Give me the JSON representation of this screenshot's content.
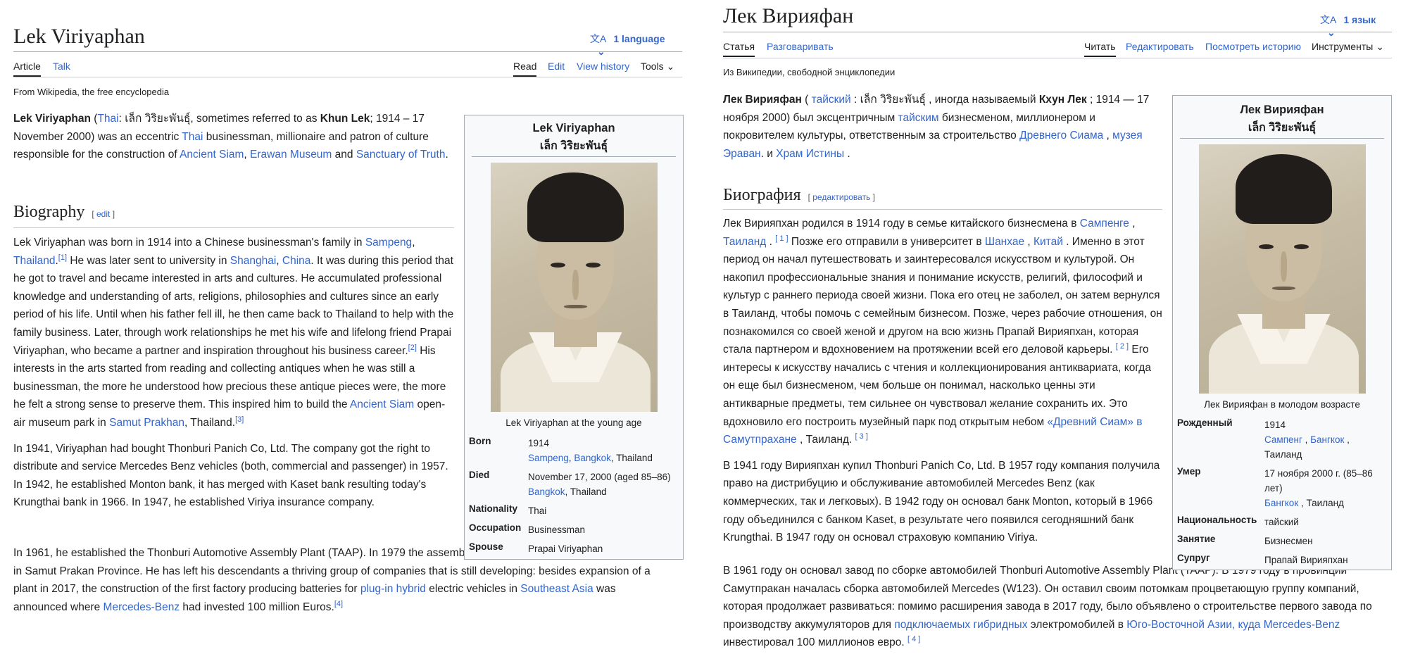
{
  "en": {
    "title": "Lek Viriyaphan",
    "language_button": "1 language",
    "tabs_left": [
      "Article",
      "Talk"
    ],
    "tabs_right": [
      "Read",
      "Edit",
      "View history",
      "Tools"
    ],
    "from": "From Wikipedia, the free encyclopedia",
    "lead": {
      "b1": "Lek Viriyaphan",
      "t1": " (",
      "l1": "Thai",
      "t2": ": เล็ก วิริยะพันธุ์, sometimes referred to as ",
      "b2": "Khun Lek",
      "t3": "; 1914 – 17 November 2000) was an eccentric ",
      "l2": "Thai",
      "t4": " businessman, millionaire and patron of culture responsible for the construction of ",
      "l3": "Ancient Siam",
      "t5": ", ",
      "l4": "Erawan Museum",
      "t6": " and ",
      "l5": "Sanctuary of Truth",
      "t7": "."
    },
    "heading": "Biography",
    "edit_label": "edit",
    "p1": {
      "t1": "Lek Viriyaphan was born in 1914 into a Chinese businessman's family in ",
      "l1": "Sampeng",
      "t2": ", ",
      "l2": "Thailand",
      "t3": ".",
      "r1": "[1]",
      "t4": " He was later sent to university in ",
      "l3": "Shanghai",
      "t5": ", ",
      "l4": "China",
      "t6": ". It was during this period that he got to travel and became interested in arts and cultures. He accumulated professional knowledge and understanding of arts, religions, philosophies and cultures since an early period of his life. Until when his father fell ill, he then came back to Thailand to help with the family business. Later, through work relationships he met his wife and lifelong friend Prapai Viriyaphan, who became a partner and inspiration throughout his business career.",
      "r2": "[2]",
      "t7": " His interests in the arts started from reading and collecting antiques when he was still a businessman, the more he understood how precious these antique pieces were, the more he felt a strong sense to preserve them. This inspired him to build the ",
      "l5": "Ancient Siam",
      "t8": " open-air museum park in ",
      "l6": "Samut Prakhan",
      "t9": ", Thailand.",
      "r3": "[3]"
    },
    "p2": "In 1941, Viriyaphan had bought Thonburi Panich Co, Ltd. The company got the right to distribute and service Mercedes Benz vehicles (both, commercial and passenger) in 1957. In 1942, he established Monton bank, it has merged with Kaset bank resulting today's Krungthai bank in 1966. In 1947, he established Viriya insurance company.",
    "p3": {
      "t1": "In 1961, he established the Thonburi Automotive Assembly Plant (TAAP). In 1979 the assembly of Mercedes cars (W123) was started in Samut Prakan Province. He has left his descendants a thriving group of companies that is still developing: besides expansion of a plant in 2017, the construction of the first factory producing batteries for ",
      "l1": "plug-in hybrid",
      "t2": " electric vehicles in ",
      "l2": "Southeast Asia",
      "t3": " was announced where ",
      "l3": "Mercedes-Benz",
      "t4": " had invested 100 million Euros.",
      "r1": "[4]"
    },
    "infobox": {
      "name": "Lek Viriyaphan",
      "native_name": "เล็ก วิริยะพันธุ์",
      "caption": "Lek Viriyaphan at the young age",
      "born_label": "Born",
      "born_year": "1914",
      "born_place_1": "Sampeng",
      "born_place_2": "Bangkok",
      "born_country": "Thailand",
      "died_label": "Died",
      "died_date": "November 17, 2000 (aged 85–86)",
      "died_place": "Bangkok",
      "died_country": "Thailand",
      "nationality_label": "Nationality",
      "nationality": "Thai",
      "occupation_label": "Occupation",
      "occupation": "Businessman",
      "spouse_label": "Spouse",
      "spouse": "Prapai Viriyaphan"
    }
  },
  "ru": {
    "title": "Лек Вирияфан",
    "language_button": "1 язык",
    "tabs_left": [
      "Статья",
      "Разговаривать"
    ],
    "tabs_right": [
      "Читать",
      "Редактировать",
      "Посмотреть историю",
      "Инструменты"
    ],
    "from": "Из Википедии, свободной энциклопедии",
    "lead": {
      "b1": "Лек Вирияфан",
      "t1": " ( ",
      "l1": "тайский",
      "t2": " : เล็ก วิริยะพันธุ์ , иногда называемый ",
      "b2": "Кхун Лек",
      "t3": " ; 1914 — 17 ноября 2000) был эксцентричным ",
      "l2": "тайским",
      "t4": " бизнесменом, миллионером и покровителем культуры, ответственным за строительство ",
      "l3": "Древнего Сиама",
      "t5": " , ",
      "l4": "музея Эраван",
      "t6": ". и ",
      "l5": "Храм Истины",
      "t7": " ."
    },
    "heading": "Биография",
    "edit_label": "редактировать",
    "p1": {
      "t1": "Лек Вирияпхан родился в 1914 году в семье китайского бизнесмена в ",
      "l1": "Сампенге",
      "t2": " , ",
      "l2": "Таиланд",
      "t3": " . ",
      "r1": "[ 1 ]",
      "t4": " Позже его отправили в университет в ",
      "l3": "Шанхае",
      "t5": " , ",
      "l4": "Китай",
      "t6": " . Именно в этот период он начал путешествовать и заинтересовался искусством и культурой. Он накопил профессиональные знания и понимание искусств, религий, философий и культур с раннего периода своей жизни. Пока его отец не заболел, он затем вернулся в Таиланд, чтобы помочь с семейным бизнесом. Позже, через рабочие отношения, он познакомился со своей женой и другом на всю жизнь Прапай Вирияпхан, которая стала партнером и вдохновением на протяжении всей его деловой карьеры. ",
      "r2": "[ 2 ]",
      "t7": " Его интересы к искусству начались с чтения и коллекционирования антиквариата, когда он еще был бизнесменом, чем больше он понимал, насколько ценны эти антикварные предметы, тем сильнее он чувствовал желание сохранить их. Это вдохновило его построить музейный парк под открытым небом ",
      "l5": "«Древний Сиам» в Самутпрахане",
      "t8": " , Таиланд. ",
      "r3": "[ 3 ]"
    },
    "p2": "В 1941 году Вирияпхан купил Thonburi Panich Co, Ltd. В 1957 году компания получила право на дистрибуцию и обслуживание автомобилей Mercedes Benz (как коммерческих, так и легковых). В 1942 году он основал банк Monton, который в 1966 году объединился с банком Kaset, в результате чего появился сегодняшний банк Krungthai. В 1947 году он основал страховую компанию Viriya.",
    "p3": {
      "t1": "В 1961 году он основал завод по сборке автомобилей Thonburi Automotive Assembly Plant (TAAP). В 1979 году в провинции Самутпракан началась сборка автомобилей Mercedes (W123). Он оставил своим потомкам процветающую группу компаний, которая продолжает развиваться: помимо расширения завода в 2017 году, было объявлено о строительстве первого завода по производству аккумуляторов для ",
      "l1": "подключаемых гибридных",
      "t2": " электромобилей в ",
      "l2": "Юго-Восточной Азии, куда Mercedes-Benz",
      "t3": " инвестировал 100 миллионов евро. ",
      "r1": "[ 4 ]"
    },
    "infobox": {
      "name": "Лек Вирияфан",
      "native_name": "เล็ก วิริยะพันธุ์",
      "caption": "Лек Вирияфан в молодом возрасте",
      "born_label": "Рожденный",
      "born_year": "1914",
      "born_place_1": "Сампенг",
      "born_place_2": "Бангкок",
      "born_country": "Таиланд",
      "died_label": "Умер",
      "died_date": "17 ноября 2000 г. (85–86 лет)",
      "died_place": "Бангкок",
      "died_country": "Таиланд",
      "nationality_label": "Национальность",
      "nationality": "тайский",
      "occupation_label": "Занятие",
      "occupation": "Бизнесмен",
      "spouse_label": "Супруг",
      "spouse": "Прапай Вирияпхан"
    }
  }
}
